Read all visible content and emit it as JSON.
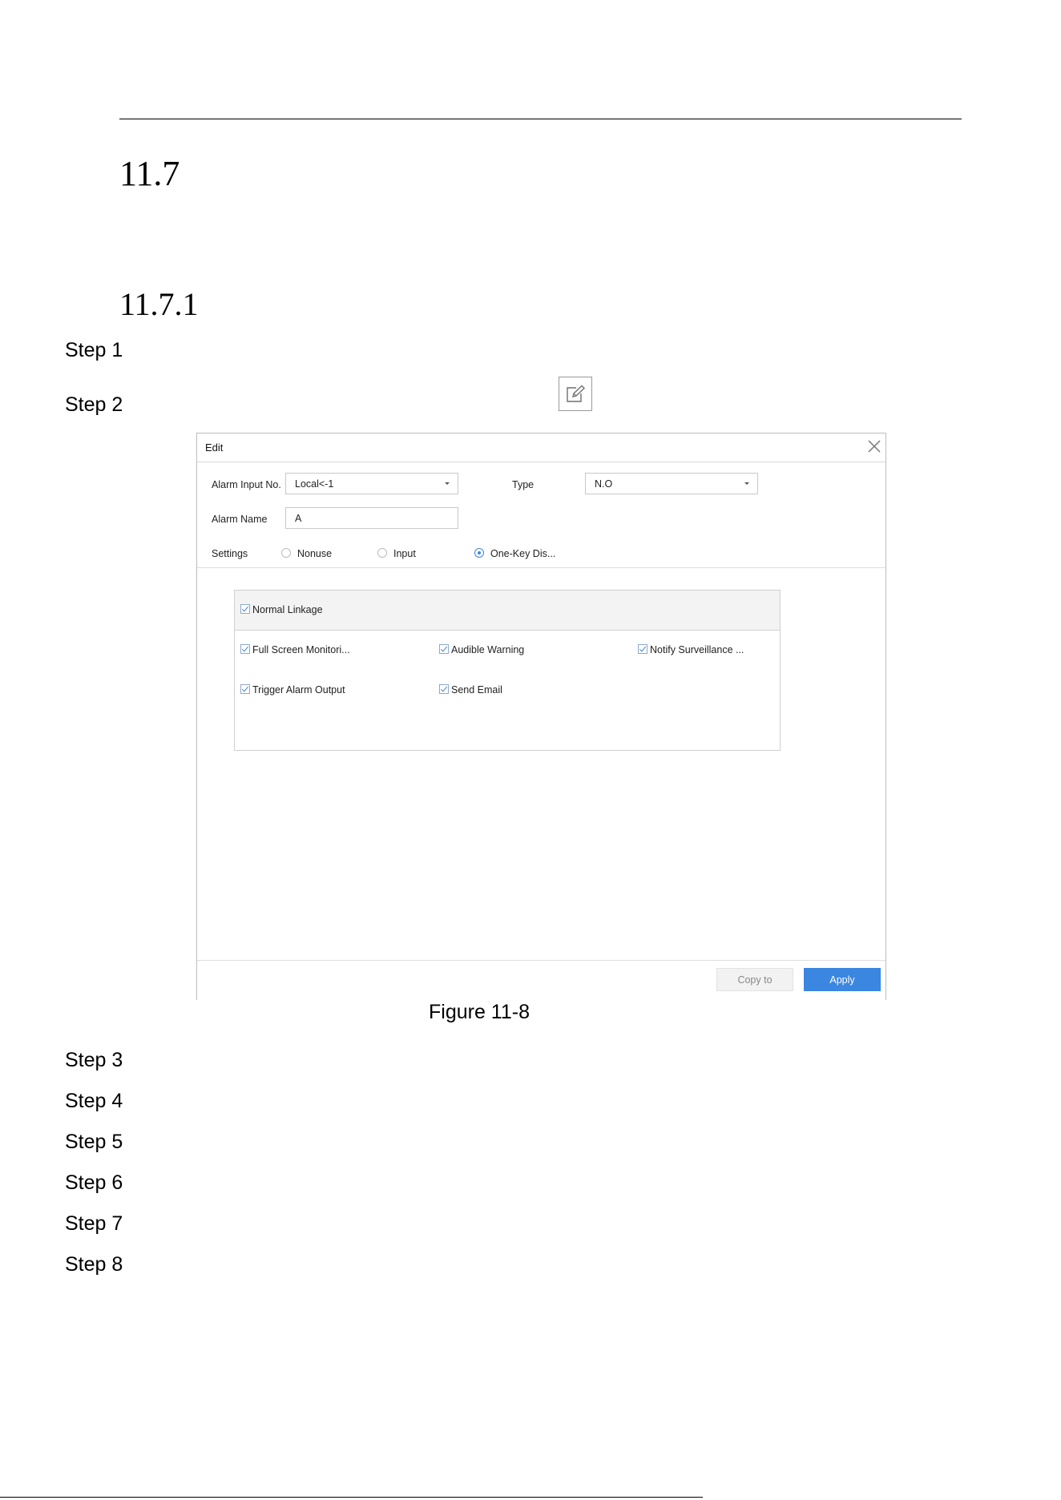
{
  "document": {
    "section_number": "11.7",
    "subsection_number": "11.7.1",
    "steps": [
      "Step 1",
      "Step 2",
      "Step 3",
      "Step 4",
      "Step 5",
      "Step 6",
      "Step 7",
      "Step 8"
    ],
    "figure_caption": "Figure 11-8",
    "inline_icon": "edit-icon"
  },
  "dialog": {
    "title": "Edit",
    "close_icon": "close-icon",
    "alarm_input_label": "Alarm Input No.",
    "alarm_input_value": "Local<-1",
    "type_label": "Type",
    "type_value": "N.O",
    "alarm_name_label": "Alarm Name",
    "alarm_name_value": "A",
    "settings_label": "Settings",
    "settings_options": [
      {
        "label": "Nonuse",
        "checked": false
      },
      {
        "label": "Input",
        "checked": false
      },
      {
        "label": "One-Key Dis...",
        "checked": true
      }
    ],
    "linkage_header": {
      "label": "Normal Linkage",
      "checked": true
    },
    "linkage_items": [
      {
        "label": "Full Screen Monitori...",
        "checked": true
      },
      {
        "label": "Audible Warning",
        "checked": true
      },
      {
        "label": "Notify Surveillance ...",
        "checked": true
      },
      {
        "label": "Trigger Alarm Output",
        "checked": true
      },
      {
        "label": "Send Email",
        "checked": true
      }
    ],
    "copy_button": "Copy to",
    "apply_button": "Apply",
    "accent_color": "#3b86e0"
  }
}
